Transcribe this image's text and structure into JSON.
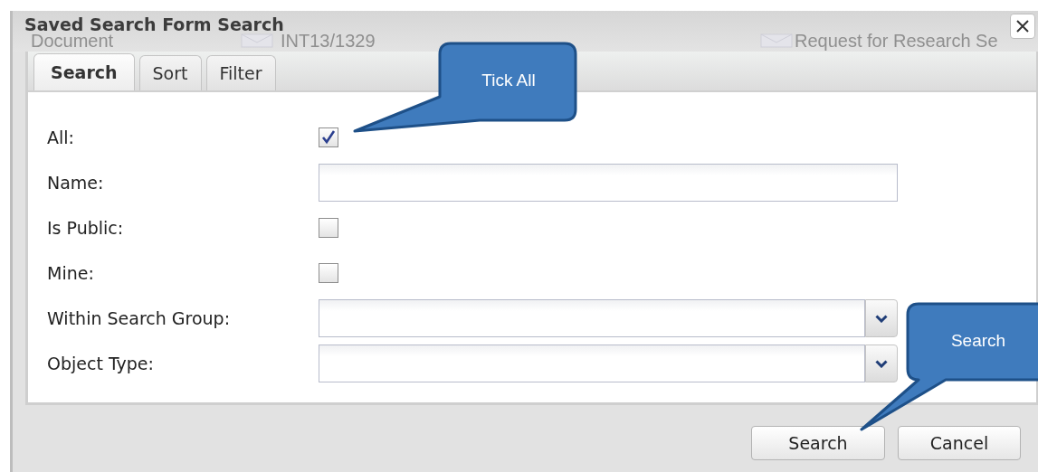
{
  "background": {
    "texts": [
      "Document",
      "INT13/1329",
      "Request for Research Se"
    ]
  },
  "dialog": {
    "title": "Saved Search Form Search",
    "tabs": [
      {
        "label": "Search",
        "selected": true
      },
      {
        "label": "Sort",
        "selected": false
      },
      {
        "label": "Filter",
        "selected": false
      }
    ],
    "fields": [
      {
        "kind": "checkbox",
        "label": "All:",
        "checked": true
      },
      {
        "kind": "text",
        "label": "Name:"
      },
      {
        "kind": "checkbox",
        "label": "Is Public:",
        "checked": false
      },
      {
        "kind": "checkbox",
        "label": "Mine:",
        "checked": false
      },
      {
        "kind": "combo",
        "label": "Within Search Group:"
      },
      {
        "kind": "combo",
        "label": "Object Type:"
      }
    ],
    "buttons": [
      "Search",
      "Cancel"
    ]
  },
  "callouts": [
    {
      "text": "Tick All"
    },
    {
      "text": "Search"
    }
  ]
}
